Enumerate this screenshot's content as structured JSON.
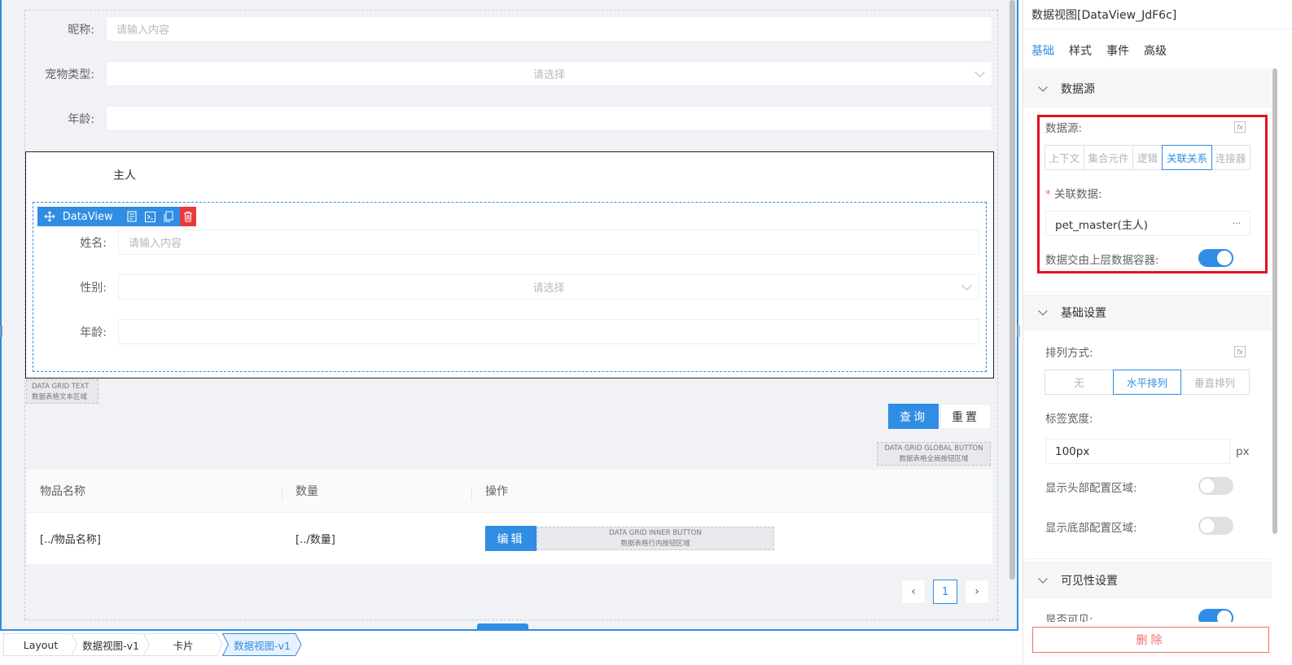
{
  "form": {
    "nickname_label": "昵称:",
    "nickname_placeholder": "请输入内容",
    "pet_type_label": "宠物类型:",
    "pet_type_placeholder": "请选择",
    "age_label": "年龄:"
  },
  "master_card": {
    "title": "主人",
    "dataview_label": "DataView",
    "name_label": "姓名:",
    "name_placeholder": "请输入内容",
    "gender_label": "性别:",
    "gender_placeholder": "请选择",
    "age_label": "年龄:"
  },
  "grid_text_tag": {
    "line1": "DATA GRID TEXT",
    "line2": "数据表格文本区域"
  },
  "buttons": {
    "query": "查询",
    "reset": "重置"
  },
  "global_button_tag": {
    "line1": "DATA GRID GLOBAL BUTTON",
    "line2": "数据表格全局按钮区域"
  },
  "table": {
    "columns": [
      "物品名称",
      "数量",
      "操作"
    ],
    "row": {
      "name": "[../物品名称]",
      "count": "[../数量]",
      "edit": "编辑"
    },
    "inner_button_tag": {
      "line1": "DATA GRID INNER BUTTON",
      "line2": "数据表格行内按钮区域"
    }
  },
  "pagination": {
    "prev": "‹",
    "current": "1",
    "next": "›"
  },
  "breadcrumb": [
    "Layout",
    "数据视图-v1",
    "卡片",
    "数据视图-v1"
  ],
  "panel": {
    "title": "数据视图[DataView_JdF6c]",
    "tabs": [
      "基础",
      "样式",
      "事件",
      "高级"
    ],
    "datasource_section": "数据源",
    "datasource_label": "数据源:",
    "datasource_options": [
      "上下文",
      "集合元件",
      "逻辑",
      "关联关系",
      "连接器"
    ],
    "datasource_active": "关联关系",
    "relation_required": "*",
    "relation_label": "关联数据:",
    "relation_value": "pet_master(主人)",
    "relation_more": "···",
    "upper_container_label": "数据交由上层数据容器:",
    "upper_container_on": true,
    "basic_section": "基础设置",
    "arrange_label": "排列方式:",
    "arrange_options": [
      "无",
      "水平排列",
      "垂直排列"
    ],
    "arrange_active": "水平排列",
    "label_width_label": "标签宽度:",
    "label_width_value": "100px",
    "label_width_unit": "px",
    "show_header_label": "显示头部配置区域:",
    "show_header_on": false,
    "show_footer_label": "显示底部配置区域:",
    "show_footer_on": false,
    "visibility_section": "可见性设置",
    "visible_label": "是否可见:",
    "visible_on": true,
    "delete": "删除"
  },
  "colors": {
    "accent": "#2f8de4",
    "danger": "#e73a3a",
    "highlight_box": "#e4111f"
  }
}
